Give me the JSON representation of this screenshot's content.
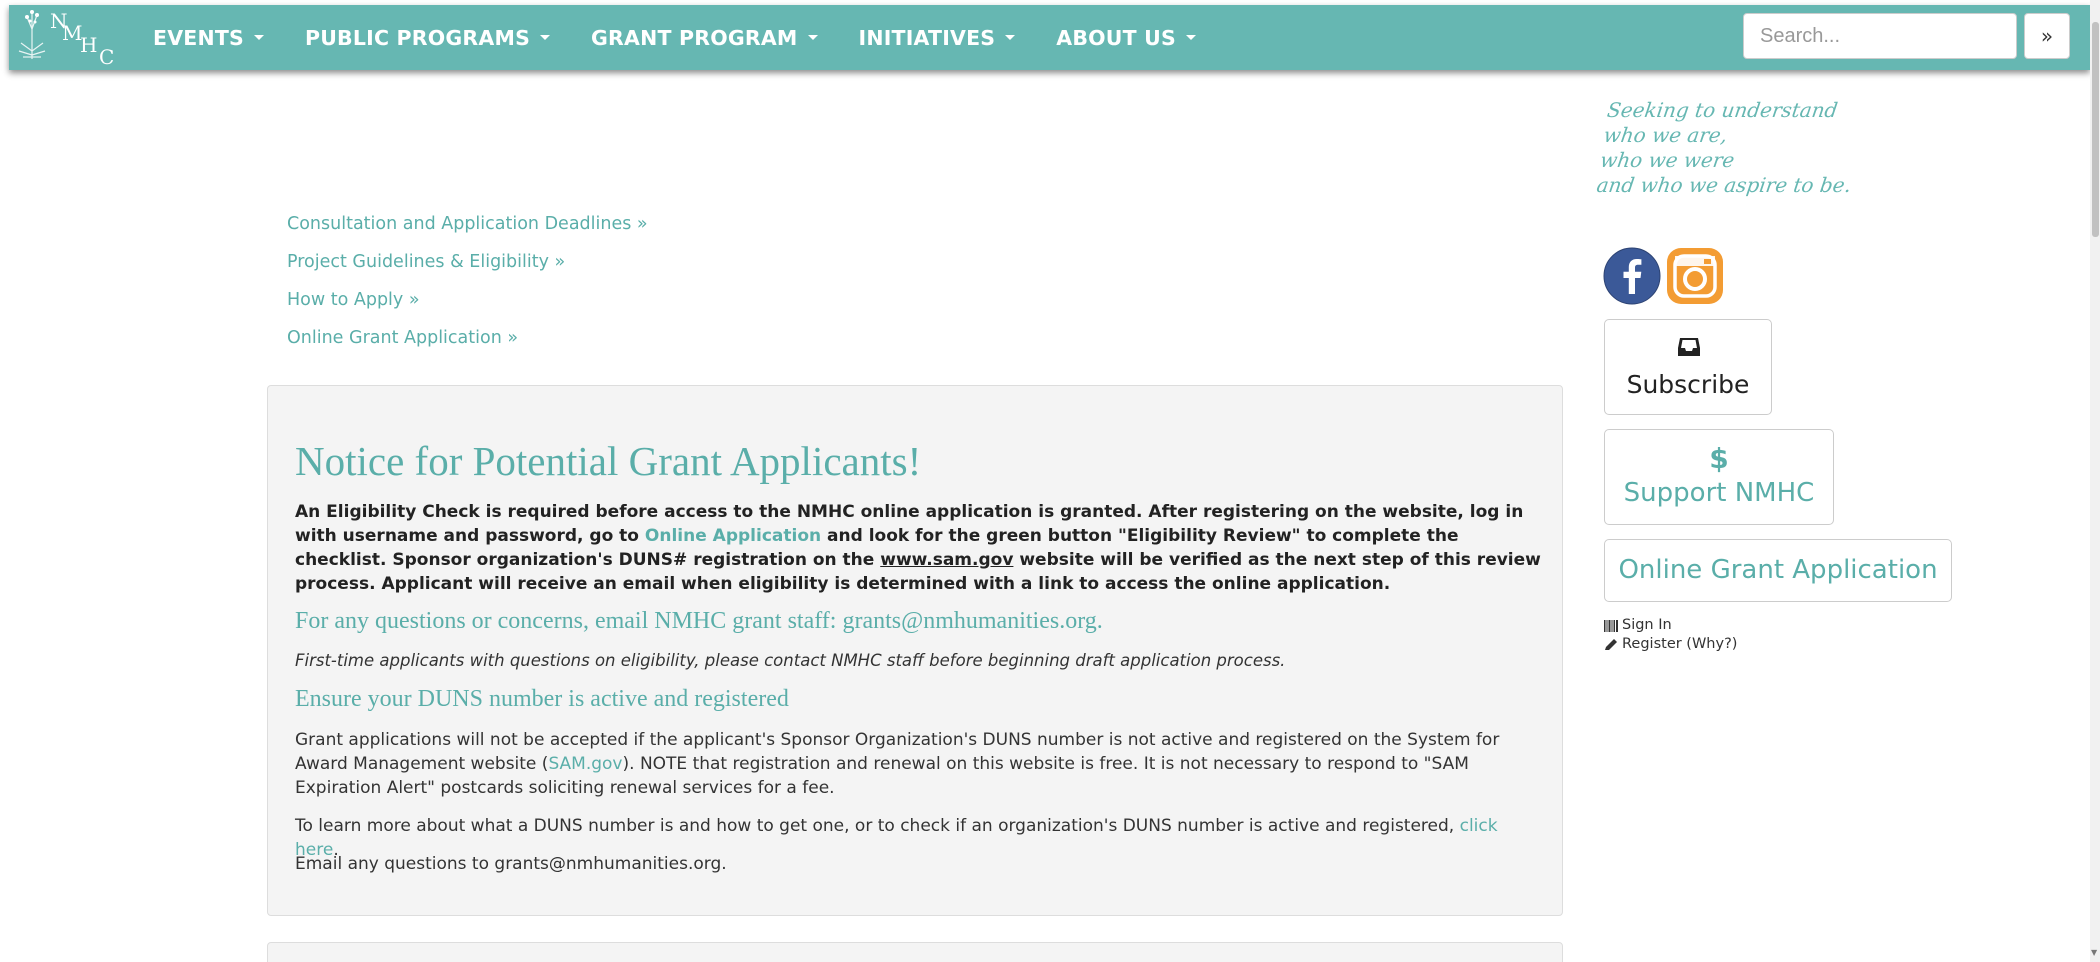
{
  "nav": {
    "logo_letters": [
      "N",
      "M",
      "H",
      "C"
    ],
    "menu": [
      {
        "label": "EVENTS"
      },
      {
        "label": "PUBLIC PROGRAMS"
      },
      {
        "label": "GRANT PROGRAM"
      },
      {
        "label": "INITIATIVES"
      },
      {
        "label": "ABOUT US"
      }
    ],
    "search_placeholder": "Search...",
    "search_button": "»"
  },
  "quick_links": [
    {
      "label": "Consultation and Application Deadlines »"
    },
    {
      "label": "Project Guidelines & Eligibility »"
    },
    {
      "label": "How to Apply »"
    },
    {
      "label": "Online Grant Application »"
    }
  ],
  "notice": {
    "title": "Notice for Potential Grant Applicants!",
    "eligibility": {
      "part1": "An Eligibility Check is required before access to the NMHC online application is granted.  After registering on the website, log in with username and password, go to ",
      "link": "Online Application",
      "part2": " and look for the green button \"Eligibility Review\" to complete the checklist. Sponsor organization's DUNS# registration on the ",
      "site": "www.sam.gov",
      "part3": " website will be verified as the next step of this review process. Applicant will receive an email when eligibility is determined with a link to access the online application."
    },
    "questions": "For any questions or concerns, email NMHC grant staff:  grants@nmhumanities.org.",
    "first_time": "First-time applicants with questions on eligibility, please contact NMHC staff before beginning draft application process.",
    "duns_heading": "Ensure your DUNS number is active and registered",
    "duns_para": {
      "part1": "Grant applications will not be accepted if the applicant's Sponsor Organization's DUNS number is not active and registered on the System for Award Management website (",
      "link": "SAM.gov",
      "part2": ").  NOTE that registration and renewal on this website is free.  It is not necessary to respond to \"SAM Expiration Alert\" postcards soliciting renewal services for a fee."
    },
    "learn_more": {
      "part1": "To learn more about what a DUNS number is and how to get one, or to check if an organization's DUNS number is active and registered, ",
      "link": "click here",
      "part2": "."
    },
    "email_line": "Email any questions to grants@nmhumanities.org."
  },
  "sidebar": {
    "tagline": [
      "Seeking to understand",
      "who we are,",
      "who we were",
      "and who we aspire to be."
    ],
    "subscribe": "Subscribe",
    "support_symbol": "$",
    "support": "Support NMHC",
    "online_app": "Online Grant Application",
    "sign_in": "Sign In",
    "register": "Register (Why?)"
  },
  "colors": {
    "brand_teal": "#66b7b2",
    "link_teal": "#5aaea9",
    "facebook": "#3b5998",
    "instagram": "#f39c33"
  }
}
